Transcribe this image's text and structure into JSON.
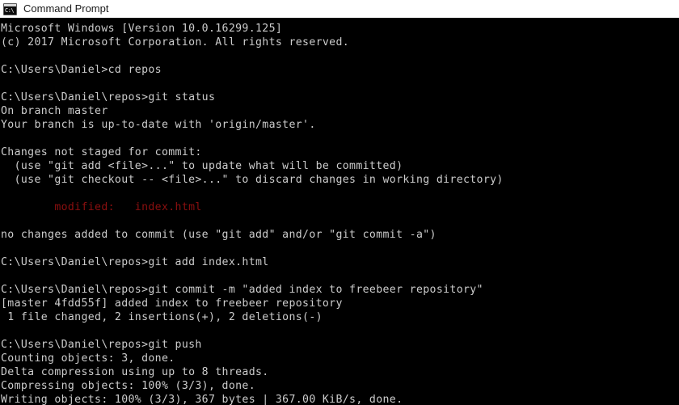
{
  "window": {
    "title": "Command Prompt",
    "icon": "command-prompt-icon",
    "icon_glyph": "C:\\",
    "titlebar_bg": "#ffffff",
    "titlebar_text_color": "#1b1b1b"
  },
  "console": {
    "background": "#000000",
    "foreground": "#cccccc",
    "error_color": "#8b0f0f",
    "lines": [
      {
        "text": "Microsoft Windows [Version 10.0.16299.125]",
        "color": "default"
      },
      {
        "text": "(c) 2017 Microsoft Corporation. All rights reserved.",
        "color": "default"
      },
      {
        "text": "",
        "color": "default"
      },
      {
        "text": "C:\\Users\\Daniel>cd repos",
        "color": "default"
      },
      {
        "text": "",
        "color": "default"
      },
      {
        "text": "C:\\Users\\Daniel\\repos>git status",
        "color": "default"
      },
      {
        "text": "On branch master",
        "color": "default"
      },
      {
        "text": "Your branch is up-to-date with 'origin/master'.",
        "color": "default"
      },
      {
        "text": "",
        "color": "default"
      },
      {
        "text": "Changes not staged for commit:",
        "color": "default"
      },
      {
        "text": "  (use \"git add <file>...\" to update what will be committed)",
        "color": "default"
      },
      {
        "text": "  (use \"git checkout -- <file>...\" to discard changes in working directory)",
        "color": "default"
      },
      {
        "text": "",
        "color": "default"
      },
      {
        "text": "        modified:   index.html",
        "color": "error"
      },
      {
        "text": "",
        "color": "default"
      },
      {
        "text": "no changes added to commit (use \"git add\" and/or \"git commit -a\")",
        "color": "default"
      },
      {
        "text": "",
        "color": "default"
      },
      {
        "text": "C:\\Users\\Daniel\\repos>git add index.html",
        "color": "default"
      },
      {
        "text": "",
        "color": "default"
      },
      {
        "text": "C:\\Users\\Daniel\\repos>git commit -m \"added index to freebeer repository\"",
        "color": "default"
      },
      {
        "text": "[master 4fdd55f] added index to freebeer repository",
        "color": "default"
      },
      {
        "text": " 1 file changed, 2 insertions(+), 2 deletions(-)",
        "color": "default"
      },
      {
        "text": "",
        "color": "default"
      },
      {
        "text": "C:\\Users\\Daniel\\repos>git push",
        "color": "default"
      },
      {
        "text": "Counting objects: 3, done.",
        "color": "default"
      },
      {
        "text": "Delta compression using up to 8 threads.",
        "color": "default"
      },
      {
        "text": "Compressing objects: 100% (3/3), done.",
        "color": "default"
      },
      {
        "text": "Writing objects: 100% (3/3), 367 bytes | 367.00 KiB/s, done.",
        "color": "default"
      }
    ]
  }
}
